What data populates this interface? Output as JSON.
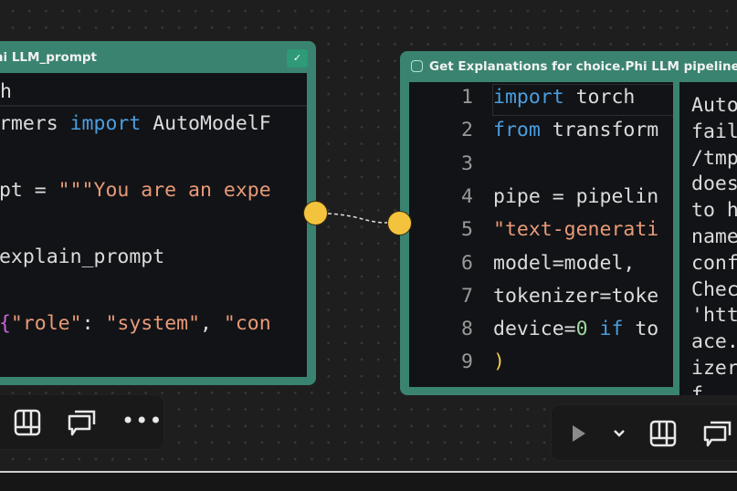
{
  "left_node": {
    "title": "Phi LLM_prompt",
    "status_icon": "check-icon",
    "tab_line": "h",
    "lines": [
      {
        "parts": [
          [
            "",
            "ormers "
          ],
          [
            "kw",
            "import"
          ],
          [
            "",
            " AutoModelF"
          ]
        ]
      },
      {
        "parts": []
      },
      {
        "parts": [
          [
            "",
            "mpt = "
          ],
          [
            "str",
            "\"\"\"You are an expe"
          ]
        ]
      },
      {
        "parts": []
      },
      {
        "parts": [
          [
            "",
            " explain_prompt"
          ]
        ]
      },
      {
        "parts": []
      },
      {
        "parts": [
          [
            "br",
            "["
          ],
          [
            "br2",
            "{"
          ],
          [
            "str",
            "\"role\""
          ],
          [
            "",
            ": "
          ],
          [
            "str",
            "\"system\""
          ],
          [
            "",
            ", "
          ],
          [
            "str",
            "\"con"
          ]
        ]
      }
    ]
  },
  "right_node": {
    "title": "Get Explanations for choice.Phi LLM pipeline",
    "icon": "python-icon",
    "line_numbers": [
      "1",
      "2",
      "3",
      "4",
      "5",
      "6",
      "7",
      "8",
      "9"
    ],
    "lines": [
      {
        "parts": [
          [
            "kw",
            "import"
          ],
          [
            "",
            " torch"
          ]
        ]
      },
      {
        "parts": [
          [
            "kw",
            "from"
          ],
          [
            "",
            " transform"
          ]
        ]
      },
      {
        "parts": []
      },
      {
        "parts": [
          [
            "",
            "pipe = pipelin"
          ]
        ]
      },
      {
        "parts": [
          [
            "str",
            "\"text-generati"
          ]
        ]
      },
      {
        "parts": [
          [
            "",
            "model=model,"
          ]
        ]
      },
      {
        "parts": [
          [
            "",
            "tokenizer=toke"
          ]
        ]
      },
      {
        "parts": [
          [
            "",
            "device="
          ],
          [
            "num",
            "0"
          ],
          [
            "",
            " "
          ],
          [
            "kw",
            "if"
          ],
          [
            "",
            " to"
          ]
        ]
      },
      {
        "parts": [
          [
            "br",
            ")"
          ]
        ]
      }
    ],
    "output_lines": [
      "Auto",
      "fail",
      "/tmp",
      "does",
      "to h",
      "name",
      "conf",
      "Chec",
      "'htt",
      "ace.",
      "izer",
      "f"
    ]
  },
  "toolbar_left": {
    "icons": [
      "layout-grid-icon",
      "comments-icon",
      "more-icon"
    ]
  },
  "toolbar_right": {
    "icons": [
      "play-icon",
      "chevron-down-icon",
      "layout-grid-icon",
      "comments-icon"
    ]
  },
  "colors": {
    "node": "#3a8370",
    "port": "#f3c33d",
    "keyword": "#4a9ee0",
    "string": "#e89a78"
  }
}
